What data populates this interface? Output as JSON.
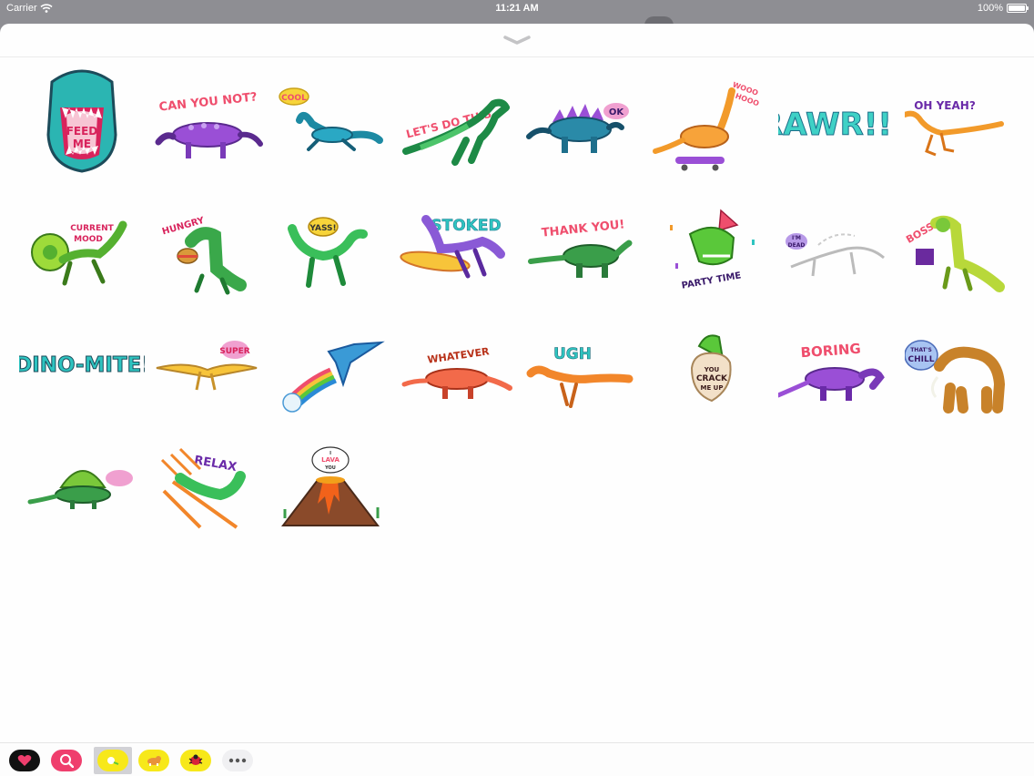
{
  "status_bar": {
    "carrier": "Carrier",
    "time": "11:21 AM",
    "battery_percent": "100%",
    "battery_level": 1.0
  },
  "colors": {
    "sheet": "#fefefe",
    "dimmed_background": "#8e8e93",
    "tray_selected": "#d2d2d6"
  },
  "drawer": {
    "handle_icon": "chevron-down-icon"
  },
  "stickers": [
    {
      "name": "feed-me",
      "text": [
        "FEED",
        "ME"
      ]
    },
    {
      "name": "can-you-not",
      "text": [
        "CAN YOU NOT?"
      ]
    },
    {
      "name": "cool",
      "text": [
        "COOL"
      ]
    },
    {
      "name": "lets-do-this",
      "text": [
        "LET'S DO THIS"
      ]
    },
    {
      "name": "ok",
      "text": [
        "OK"
      ]
    },
    {
      "name": "wooo-hooo",
      "text": [
        "WOOO",
        "HOOO"
      ]
    },
    {
      "name": "rawr",
      "text": [
        "RAWR!!"
      ]
    },
    {
      "name": "oh-yeah",
      "text": [
        "OH YEAH?"
      ]
    },
    {
      "name": "current-mood",
      "text": [
        "CURRENT",
        "MOOD"
      ]
    },
    {
      "name": "hungry",
      "text": [
        "HUNGRY"
      ]
    },
    {
      "name": "yass",
      "text": [
        "YASS!"
      ]
    },
    {
      "name": "stoked",
      "text": [
        "STOKED"
      ]
    },
    {
      "name": "thank-you",
      "text": [
        "THANK YOU!"
      ]
    },
    {
      "name": "party-time",
      "text": [
        "PARTY TIME"
      ]
    },
    {
      "name": "im-dead",
      "text": [
        "I'M",
        "DEAD"
      ]
    },
    {
      "name": "bossy",
      "text": [
        "BOSSY"
      ]
    },
    {
      "name": "dino-mite",
      "text": [
        "DINO-MITE!"
      ]
    },
    {
      "name": "super",
      "text": [
        "SUPER"
      ]
    },
    {
      "name": "rainbow-pterodactyl",
      "text": []
    },
    {
      "name": "whatever",
      "text": [
        "WHATEVER"
      ]
    },
    {
      "name": "ugh",
      "text": [
        "UGH"
      ]
    },
    {
      "name": "you-crack-me-up",
      "text": [
        "YOU",
        "CRACK",
        "ME UP"
      ]
    },
    {
      "name": "boring",
      "text": [
        "BORING"
      ]
    },
    {
      "name": "thats-chill",
      "text": [
        "THAT'S",
        "CHILL"
      ]
    },
    {
      "name": "dimetrodon-bubble",
      "text": []
    },
    {
      "name": "relax",
      "text": [
        "RELAX"
      ]
    },
    {
      "name": "i-lava-you",
      "text": [
        "I",
        "LAVA",
        "YOU"
      ]
    }
  ],
  "tray": {
    "apps": [
      {
        "name": "heart-app",
        "icon": "heart-icon",
        "selected": false
      },
      {
        "name": "search-app",
        "icon": "magnifier-heart-icon",
        "selected": false
      },
      {
        "name": "dino-stickers-app",
        "icon": "dino-app-icon",
        "selected": true
      },
      {
        "name": "corgi-app",
        "icon": "corgi-icon",
        "selected": false
      },
      {
        "name": "bug-app",
        "icon": "bug-icon",
        "selected": false
      },
      {
        "name": "more-apps",
        "icon": "more-icon",
        "selected": false
      }
    ]
  }
}
